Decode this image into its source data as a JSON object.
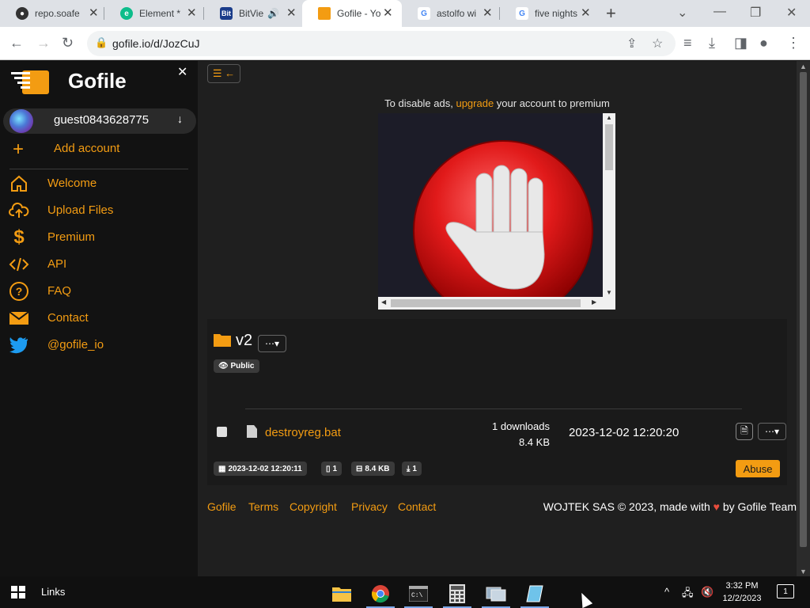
{
  "tabs": [
    {
      "label": "repo.soafe",
      "icon": "github-icon",
      "active": false
    },
    {
      "label": "Element *",
      "icon": "element-icon",
      "active": false
    },
    {
      "label": "BitVie",
      "icon": "bitview-icon",
      "active": false
    },
    {
      "label": "Gofile - Yo",
      "icon": "gofile-icon",
      "active": true
    },
    {
      "label": "astolfo wi",
      "icon": "google-icon",
      "active": false
    },
    {
      "label": "five nights",
      "icon": "google-icon",
      "active": false
    }
  ],
  "address_bar": {
    "url": "gofile.io/d/JozCuJ"
  },
  "sidebar": {
    "brand": "Gofile",
    "account": {
      "name": "guest0843628775"
    },
    "add_account_label": "Add account",
    "items": [
      {
        "label": "Welcome",
        "icon": "home-icon"
      },
      {
        "label": "Upload Files",
        "icon": "upload-cloud-icon"
      },
      {
        "label": "Premium",
        "icon": "dollar-icon"
      },
      {
        "label": "API",
        "icon": "code-icon"
      },
      {
        "label": "FAQ",
        "icon": "question-icon"
      },
      {
        "label": "Contact",
        "icon": "envelope-icon"
      },
      {
        "label": "@gofile_io",
        "icon": "twitter-icon"
      }
    ]
  },
  "ad": {
    "prefix": "To disable ads, ",
    "link": "upgrade",
    "suffix": " your account to premium"
  },
  "folder": {
    "name": "v2",
    "visibility": "Public",
    "files": [
      {
        "name": "destroyreg.bat",
        "downloads": "1 downloads",
        "size": "8.4 KB",
        "date": "2023-12-02 12:20:20"
      }
    ],
    "meta": {
      "created": "2023-12-02 12:20:11",
      "file_count": "1",
      "total_size": "8.4 KB",
      "download_count": "1"
    },
    "abuse_label": "Abuse"
  },
  "footer": {
    "links": [
      "Gofile",
      "Terms",
      "Copyright",
      "Privacy",
      "Contact"
    ],
    "copyright_prefix": "WOJTEK SAS © 2023, made with ",
    "copyright_suffix": " by Gofile Team"
  },
  "taskbar": {
    "links_label": "Links",
    "time": "3:32 PM",
    "date": "12/2/2023",
    "notification_count": "1"
  },
  "colors": {
    "accent": "#f39c12",
    "sidebar_bg": "#121212",
    "main_bg": "#1f1f1f"
  }
}
